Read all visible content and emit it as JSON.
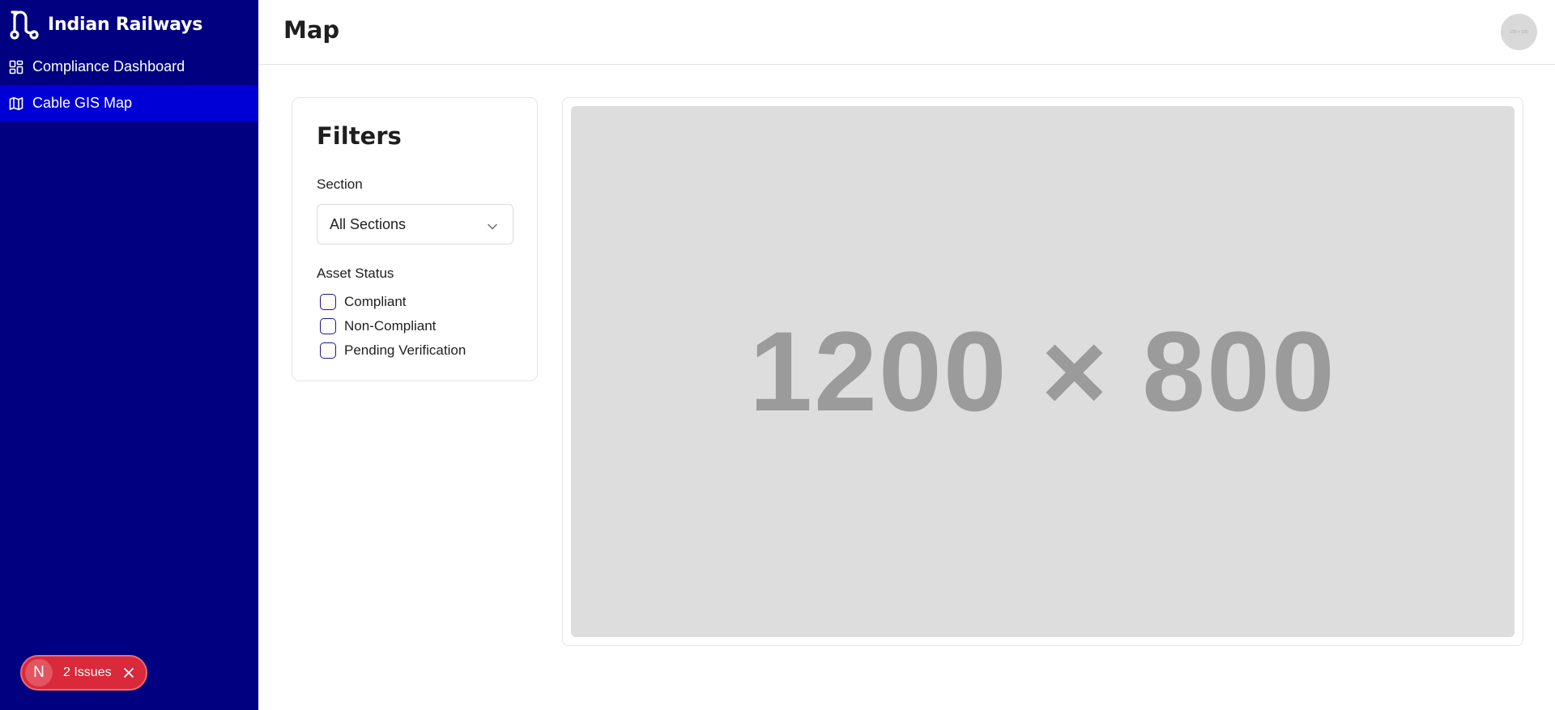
{
  "sidebar": {
    "brand_title": "Indian Railways",
    "brand_icon": "route-icon",
    "items": [
      {
        "label": "Compliance Dashboard",
        "icon": "dashboard-grid-icon",
        "active": false
      },
      {
        "label": "Cable GIS Map",
        "icon": "map-icon",
        "active": true
      }
    ],
    "issues": {
      "badge": "N",
      "label": "2 Issues"
    }
  },
  "header": {
    "title": "Map",
    "avatar_text": "100 × 100"
  },
  "filters": {
    "title": "Filters",
    "section_label": "Section",
    "section_value": "All Sections",
    "status_label": "Asset Status",
    "statuses": [
      {
        "label": "Compliant",
        "checked": false
      },
      {
        "label": "Non-Compliant",
        "checked": false
      },
      {
        "label": "Pending Verification",
        "checked": false
      }
    ]
  },
  "map": {
    "placeholder_text": "1200 × 800"
  },
  "colors": {
    "sidebar_bg": "#000080",
    "active_item_bg": "#0000d6",
    "issues_bg": "#d9293a"
  }
}
